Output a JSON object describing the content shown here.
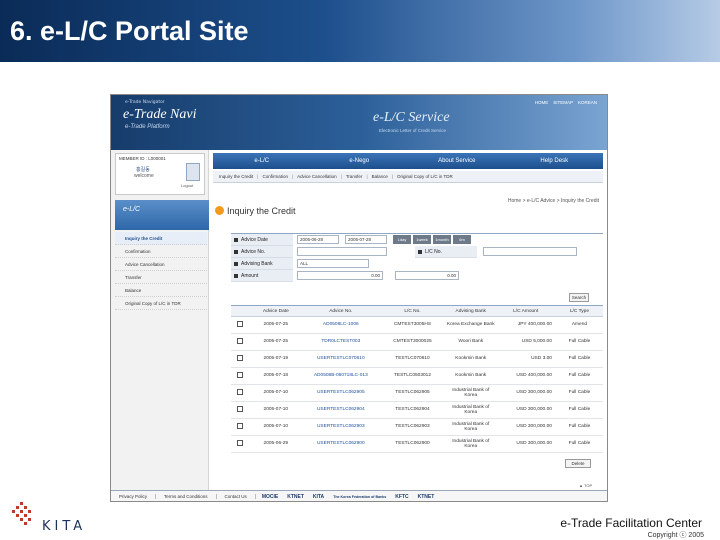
{
  "slide": {
    "title": "6. e-L/C Portal Site",
    "footer_org": "e-Trade Facilitation Center",
    "copyright": "Copyright ⓒ 2005",
    "logo_text": "KITA"
  },
  "portal": {
    "brand_small": "e-Trade Navigator",
    "brand_title": "e-Trade Navi",
    "brand_sub": "e-Trade Platform",
    "top_links": [
      "HOME",
      "SITEMAP",
      "KOREAN"
    ],
    "service_title": "e-L/C Service",
    "service_sub": "Electronic Letter of Credit Service",
    "member": {
      "id": "MEMBER ID : L000001",
      "name": "홍길동",
      "welcome": "welcome",
      "logout": "Logout"
    },
    "section_title": "e-L/C",
    "side_menu": [
      "Inquiry the Credit",
      "Confirmation",
      "Advice Cancellation",
      "Transfer",
      "Balance",
      "Original Copy of L/C in TDR"
    ],
    "nav": [
      "e-L/C",
      "e-Nego",
      "About Service",
      "Help Desk"
    ],
    "sub_nav": [
      "Inquiry the Credit",
      "Confirmation",
      "Advice Cancellation",
      "Transfer",
      "Balance",
      "Original Copy of L/C in TDR"
    ],
    "page_heading": "Inquiry the Credit",
    "breadcrumb": "Home > e-L/C Advice > Inquiry the Credit",
    "form": {
      "advice_date_label": "Advice Date",
      "date_from": "2005-06-28",
      "date_to": "2005-07-28",
      "period_buttons": [
        "1day",
        "1week",
        "1month",
        "6m"
      ],
      "advice_no_label": "Advice No.",
      "lc_no_label": "L/C No.",
      "advising_bank_label": "Advising Bank",
      "advising_bank_value": "ALL",
      "amount_label": "Amount",
      "amount_from": "0.00",
      "amount_to": "0.00"
    },
    "search_button": "Search",
    "table": {
      "headers": [
        "",
        "Advice Date",
        "Advice No.",
        "L/C No.",
        "Advising Bank",
        "L/C Amount",
        "L/C Type"
      ],
      "rows": [
        [
          "2005-07-25",
          "AD0508LC-1006",
          "CMTEST3005HS",
          "Korea Exchange Bank",
          "JPY",
          "400,000.00",
          "Amend"
        ],
        [
          "2005-07-25",
          "TDR0LCTEST003",
          "CMTEST3000025",
          "Woori Bank",
          "USD",
          "5,000.00",
          "Full Cable"
        ],
        [
          "2005-07-19",
          "USERTESTLC070610",
          "TESTLC070610",
          "Kookmin Bank",
          "USD",
          "3.00",
          "Full Cable"
        ],
        [
          "2005-07-18",
          "AD0508B-050718LC-013",
          "TESTLC0503012",
          "Kookmin Bank",
          "USD",
          "400,000.00",
          "Full Cable"
        ],
        [
          "2005-07-10",
          "USERTESTLC062905",
          "TESTLC062905",
          "Industrial Bank of Korea",
          "USD",
          "300,000.00",
          "Full Cable"
        ],
        [
          "2005-07-10",
          "USERTESTLC062904",
          "TESTLC062904",
          "Industrial Bank of Korea",
          "USD",
          "300,000.00",
          "Full Cable"
        ],
        [
          "2005-07-10",
          "USERTESTLC062903",
          "TESTLC062903",
          "Industrial Bank of Korea",
          "USD",
          "300,000.00",
          "Full Cable"
        ],
        [
          "2005-06-29",
          "USERTESTLC062900",
          "TESTLC062900",
          "Industrial Bank of Korea",
          "USD",
          "300,000.00",
          "Full Cable"
        ]
      ]
    },
    "delete_button": "Delete",
    "top_link": "▲ TOP",
    "footer_links": [
      "Privacy Policy",
      "Terms and Conditions",
      "Contact Us"
    ],
    "footer_logos": [
      "MOCIE",
      "KTNET",
      "KITA",
      "The Korea Federation of Banks",
      "KFTC",
      "KTNET"
    ]
  }
}
